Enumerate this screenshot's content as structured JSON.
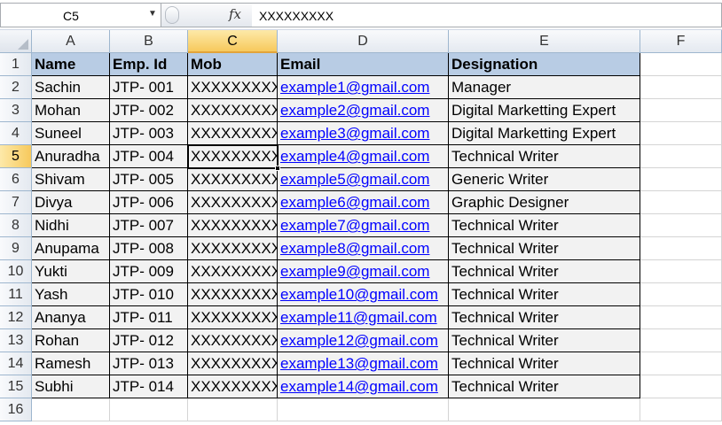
{
  "formula_bar": {
    "name_box": "C5",
    "fx_label": "fx",
    "formula": "XXXXXXXXX"
  },
  "columns": [
    "A",
    "B",
    "C",
    "D",
    "E",
    "F"
  ],
  "selected_column": "C",
  "selected_row": "5",
  "rows": [
    "1",
    "2",
    "3",
    "4",
    "5",
    "6",
    "7",
    "8",
    "9",
    "10",
    "11",
    "12",
    "13",
    "14",
    "15",
    "16"
  ],
  "table": {
    "headers": [
      "Name",
      "Emp. Id",
      "Mob",
      "Email",
      "Designation"
    ],
    "records": [
      [
        "Sachin",
        "JTP- 001",
        "XXXXXXXXX",
        "example1@gmail.com",
        "Manager"
      ],
      [
        "Mohan",
        "JTP- 002",
        "XXXXXXXXX",
        "example2@gmail.com",
        "Digital Marketting Expert"
      ],
      [
        "Suneel",
        "JTP- 003",
        "XXXXXXXXX",
        "example3@gmail.com",
        "Digital Marketting Expert"
      ],
      [
        "Anuradha",
        "JTP- 004",
        "XXXXXXXXX",
        "example4@gmail.com",
        "Technical Writer"
      ],
      [
        "Shivam",
        "JTP- 005",
        "XXXXXXXXX",
        "example5@gmail.com",
        "Generic Writer"
      ],
      [
        "Divya",
        "JTP- 006",
        "XXXXXXXXX",
        "example6@gmail.com",
        "Graphic Designer"
      ],
      [
        "Nidhi",
        "JTP- 007",
        "XXXXXXXXX",
        "example7@gmail.com",
        "Technical Writer"
      ],
      [
        "Anupama",
        "JTP- 008",
        "XXXXXXXXX",
        "example8@gmail.com",
        "Technical Writer"
      ],
      [
        "Yukti",
        "JTP- 009",
        "XXXXXXXXX",
        "example9@gmail.com",
        "Technical Writer"
      ],
      [
        "Yash",
        "JTP- 010",
        "XXXXXXXXX",
        "example10@gmail.com",
        "Technical Writer"
      ],
      [
        "Ananya",
        "JTP- 011",
        "XXXXXXXXX",
        "example11@gmail.com",
        "Technical Writer"
      ],
      [
        "Rohan",
        "JTP- 012",
        "XXXXXXXXX",
        "example12@gmail.com",
        "Technical Writer"
      ],
      [
        "Ramesh",
        "JTP- 013",
        "XXXXXXXXX",
        "example13@gmail.com",
        "Technical Writer"
      ],
      [
        "Subhi",
        "JTP- 014",
        "XXXXXXXXX",
        "example14@gmail.com",
        "Technical Writer"
      ]
    ]
  },
  "colors": {
    "header_fill": "#b8cce4",
    "data_fill": "#f2f2f2",
    "link": "#0000ff",
    "selection_header": "#f7c95c"
  }
}
